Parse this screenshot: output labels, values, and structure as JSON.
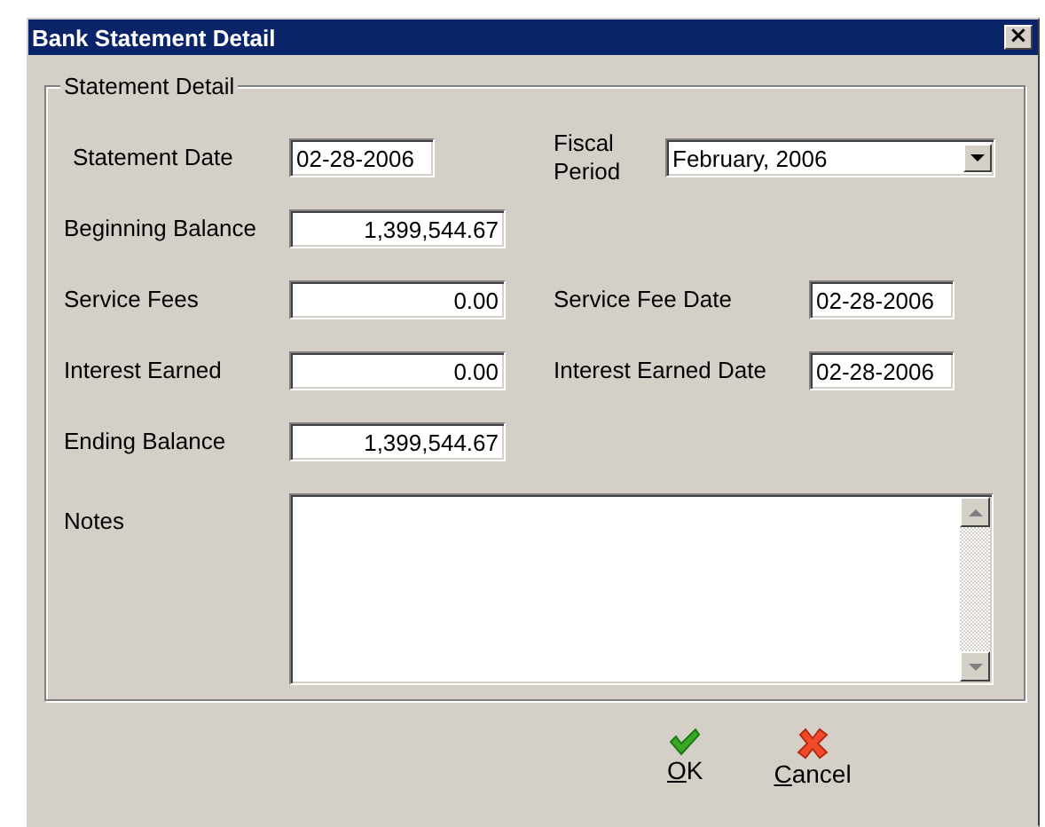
{
  "window": {
    "title": "Bank Statement Detail",
    "close": "×"
  },
  "group": {
    "title": "Statement Detail"
  },
  "rows": [
    {
      "left": {
        "label": "Statement Date",
        "value": "02-28-2006",
        "kind": "date"
      },
      "right": {
        "label": "Fiscal Period",
        "value": "February, 2006",
        "kind": "dropdown"
      }
    },
    {
      "left": {
        "label": "Beginning Balance",
        "value": "1,399,544.67",
        "kind": "amount"
      }
    },
    {
      "left": {
        "label": "Service Fees",
        "value": "0.00",
        "kind": "amount"
      },
      "right": {
        "label": "Service Fee Date",
        "value": "02-28-2006",
        "kind": "date"
      }
    },
    {
      "left": {
        "label": "Interest Earned",
        "value": "0.00",
        "kind": "amount"
      },
      "right": {
        "label": "Interest Earned Date",
        "value": "02-28-2006",
        "kind": "date"
      }
    },
    {
      "left": {
        "label": "Ending Balance",
        "value": "1,399,544.67",
        "kind": "amount"
      }
    }
  ],
  "notes": {
    "label": "Notes"
  },
  "buttons": [
    {
      "label": "OK",
      "kind": "ok"
    },
    {
      "label": "Cancel",
      "kind": "cancel"
    }
  ]
}
